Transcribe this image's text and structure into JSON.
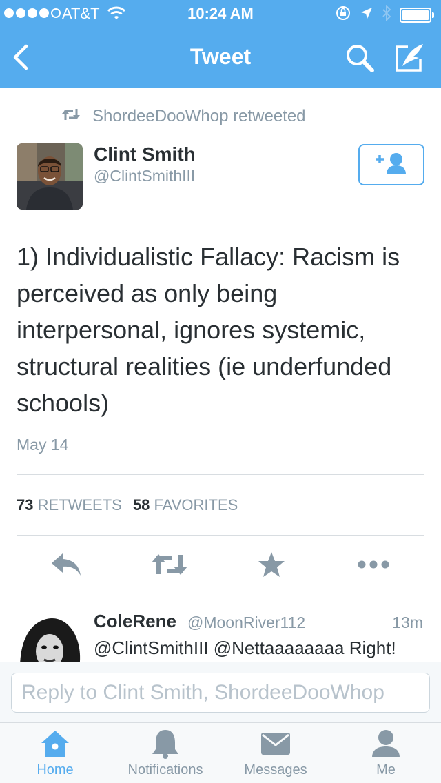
{
  "status_bar": {
    "carrier": "AT&T",
    "time": "10:24 AM",
    "signal_bars": 4,
    "signal_max": 5,
    "battery_level": 1.0
  },
  "nav": {
    "title": "Tweet",
    "icons": [
      "back-chevron-icon",
      "search-icon",
      "compose-icon"
    ]
  },
  "tweet": {
    "retweeted_by": "ShordeeDooWhop retweeted",
    "author_name": "Clint Smith",
    "author_handle": "@ClintSmithIII",
    "text": "1) Individualistic Fallacy: Racism is perceived as only being interpersonal, ignores systemic, structural realities (ie underfunded schools)",
    "date": "May 14",
    "retweets_count": "73",
    "retweets_label": "RETWEETS",
    "favorites_count": "58",
    "favorites_label": "FAVORITES",
    "action_icons": [
      "reply-icon",
      "retweet-icon",
      "favorite-star-icon",
      "more-icon"
    ]
  },
  "reply": {
    "name": "ColeRene",
    "handle": "@MoonRiver112",
    "time": "13m",
    "text": "@ClintSmithIII @Nettaaaaaaaa Right!"
  },
  "composer": {
    "placeholder": "Reply to Clint Smith, ShordeeDooWhop"
  },
  "tabs": [
    {
      "label": "Home",
      "icon": "home-icon",
      "active": true
    },
    {
      "label": "Notifications",
      "icon": "bell-icon",
      "active": false
    },
    {
      "label": "Messages",
      "icon": "envelope-icon",
      "active": false
    },
    {
      "label": "Me",
      "icon": "person-icon",
      "active": false
    }
  ],
  "colors": {
    "brand": "#55acee",
    "text": "#292f33",
    "muted": "#8899a6"
  }
}
